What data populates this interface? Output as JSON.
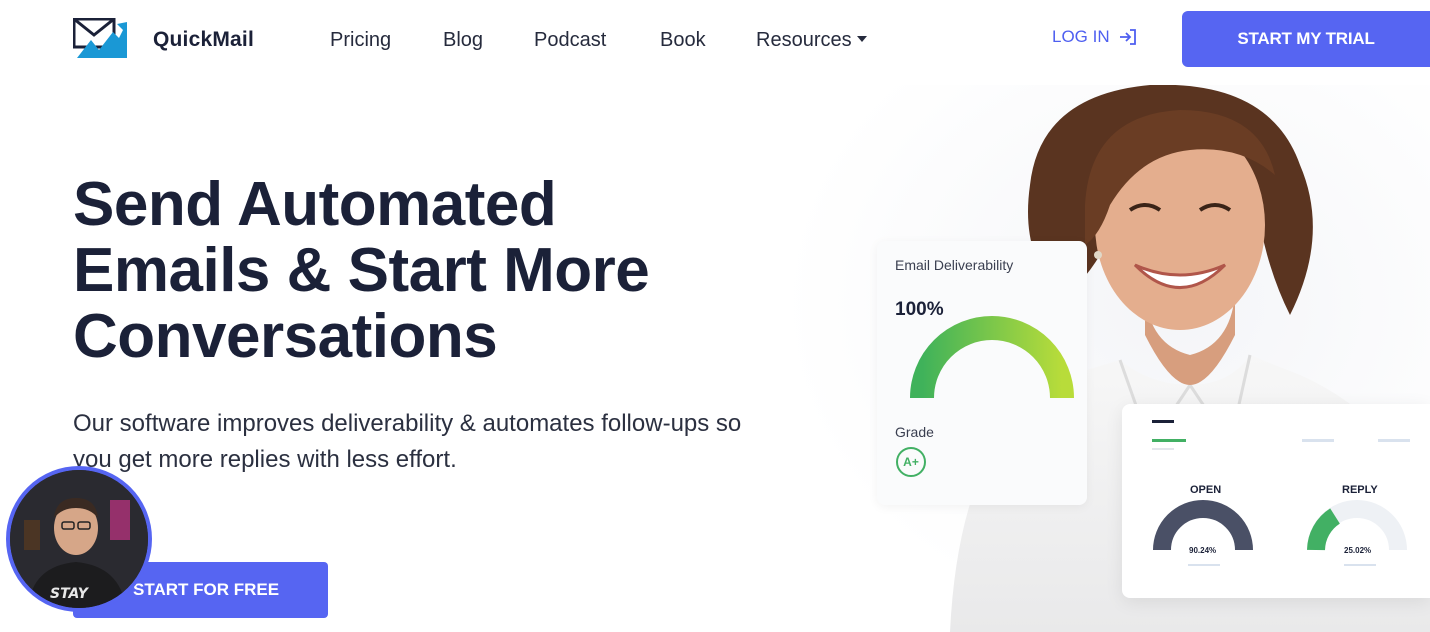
{
  "brand": {
    "name": "QuickMail"
  },
  "nav": {
    "links": [
      "Pricing",
      "Blog",
      "Podcast",
      "Book",
      "Resources"
    ],
    "login_label": "LOG IN",
    "trial_label": "START MY TRIAL"
  },
  "hero": {
    "title": "Send Automated Emails & Start More Conversations",
    "subtitle": "Our software improves deliverability & automates follow-ups so you get more replies with less effort.",
    "cta_label": "START FOR FREE"
  },
  "deliverability_card": {
    "label": "Email Deliverability",
    "value": "100%",
    "grade_label": "Grade",
    "grade": "A+"
  },
  "stats_card": {
    "open_label": "OPEN",
    "open_value": "90.24%",
    "reply_label": "REPLY",
    "reply_value": "25.02%"
  },
  "colors": {
    "accent": "#5665f2",
    "text": "#1b2138",
    "green": "#42b064",
    "gauge_dark": "#4a5066"
  }
}
